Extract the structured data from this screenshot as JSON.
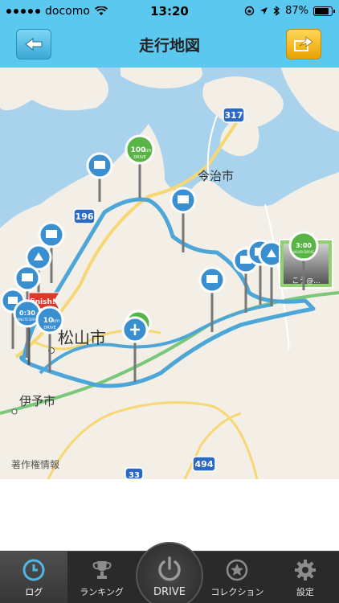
{
  "status_bar": {
    "carrier": "docomo",
    "time": "13:20",
    "battery": "87%"
  },
  "nav": {
    "title": "走行地図",
    "back_icon": "back-arrow-icon",
    "share_icon": "share-icon"
  },
  "map": {
    "road_labels": [
      "317",
      "196",
      "494",
      "33"
    ],
    "place_labels": [
      "今治市",
      "松山市",
      "伊予市"
    ],
    "copyright": "著作権情報",
    "badges": {
      "badge_100": {
        "value": "100",
        "unit": "km",
        "caption": "DRIVE"
      },
      "badge_10": {
        "value": "10",
        "unit": "km",
        "caption": "DRIVE"
      },
      "badge_030": {
        "value": "0:30",
        "caption": "MINUTE DRIVE"
      },
      "badge_300": {
        "value": "3:00",
        "caption": "HOUR DRIVE"
      },
      "finish": "finish!",
      "photo_caption": "こう@..."
    },
    "colors": {
      "route": "#4da6d8",
      "marker": "#3a8fd0",
      "road_green": "#7ac77a",
      "road_yellow": "#f7d774",
      "sea": "#a9d3ec",
      "land": "#f3efe7"
    }
  },
  "tabs": [
    {
      "label": "ログ",
      "icon": "clock-icon"
    },
    {
      "label": "ランキング",
      "icon": "trophy-icon"
    },
    {
      "label": "DRIVE",
      "icon": "power-icon"
    },
    {
      "label": "コレクション",
      "icon": "star-icon"
    },
    {
      "label": "設定",
      "icon": "gear-icon"
    }
  ]
}
